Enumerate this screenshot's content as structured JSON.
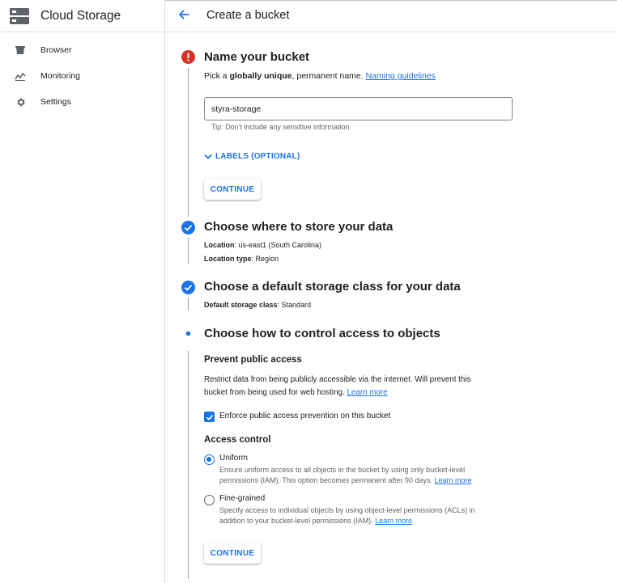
{
  "app": {
    "product_title": "Cloud Storage",
    "page_title": "Create a bucket"
  },
  "sidebar": {
    "items": [
      {
        "label": "Browser",
        "icon": "bucket-icon"
      },
      {
        "label": "Monitoring",
        "icon": "chart-icon"
      },
      {
        "label": "Settings",
        "icon": "gear-icon"
      }
    ]
  },
  "steps": {
    "name": {
      "title": "Name your bucket",
      "desc_prefix": "Pick a ",
      "desc_bold": "globally unique",
      "desc_suffix": ", permanent name.",
      "desc_link": "Naming guidelines",
      "input_value": "styra-storage",
      "tip": "Tip: Don't include any sensitive information",
      "labels_toggle": "LABELS (OPTIONAL)",
      "continue_label": "CONTINUE"
    },
    "location": {
      "title": "Choose where to store your data",
      "location_label": "Location",
      "location_value": ": us-east1 (South Carolina)",
      "type_label": "Location type",
      "type_value": ": Region"
    },
    "storage_class": {
      "title": "Choose a default storage class for your data",
      "label": "Default storage class",
      "value": ": Standard"
    },
    "access": {
      "title": "Choose how to control access to objects",
      "prevent_heading": "Prevent public access",
      "prevent_desc_1": "Restrict data from being publicly accessible via the internet. Will prevent this",
      "prevent_desc_2": "bucket from being used for web hosting.",
      "prevent_link": "Learn more",
      "enforce_label": "Enforce public access prevention on this bucket",
      "enforce_checked": true,
      "access_heading": "Access control",
      "uniform_title": "Uniform",
      "uniform_desc_1": "Ensure uniform access to all objects in the bucket by using only bucket-level",
      "uniform_desc_2": "permissions (IAM). This option becomes permanent after 90 days.",
      "uniform_link": "Learn more",
      "fine_title": "Fine-grained",
      "fine_desc_1": "Specify access to individual objects by using object-level permissions (ACLs) in",
      "fine_desc_2": "addition to your bucket-level permissions (IAM).",
      "fine_link": "Learn more",
      "selected": "uniform",
      "continue_label": "CONTINUE"
    }
  },
  "colors": {
    "accent": "#1a73e8",
    "error": "#d93025",
    "text": "#202124",
    "secondary_text": "#5f6368",
    "divider": "#dadce0"
  }
}
